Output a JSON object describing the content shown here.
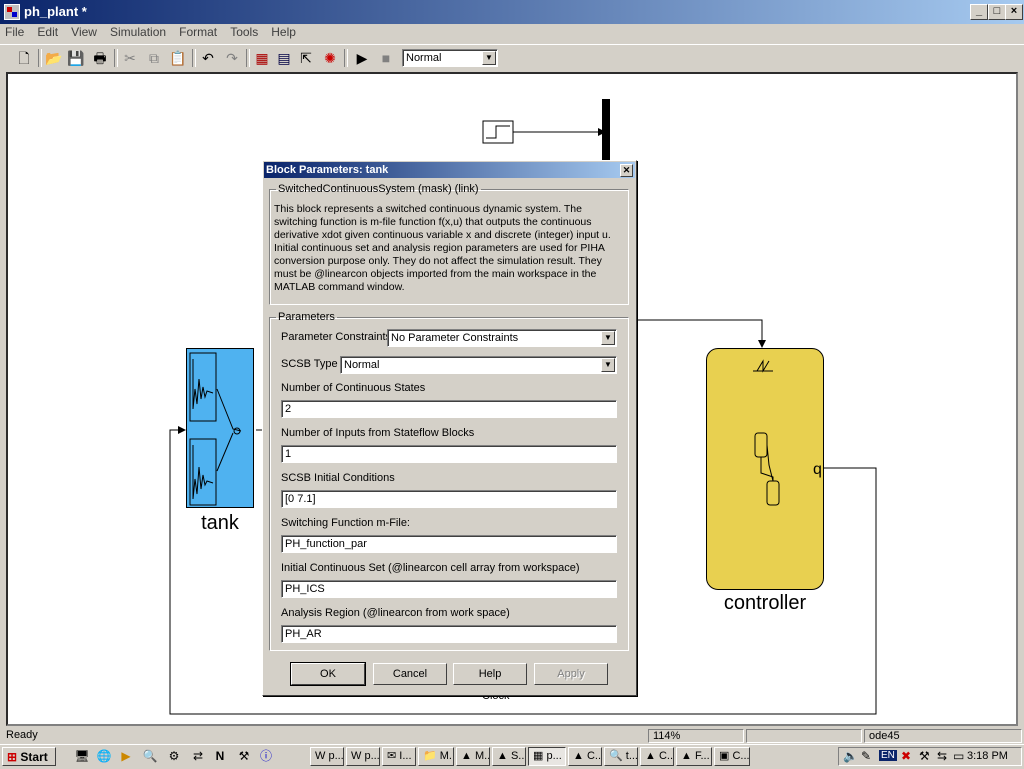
{
  "window": {
    "title": "ph_plant *"
  },
  "menu": [
    "File",
    "Edit",
    "View",
    "Simulation",
    "Format",
    "Tools",
    "Help"
  ],
  "toolbar": {
    "mode_select": "Normal"
  },
  "canvas": {
    "tank_label": "tank",
    "controller_label": "controller",
    "controller_port": "q",
    "hidden_label": "Clock"
  },
  "dialog": {
    "title": "Block Parameters: tank",
    "mask_group": "SwitchedContinuousSystem (mask) (link)",
    "description": "This block represents a switched continuous dynamic system. The switching function is m-file function f(x,u) that outputs the continuous derivative xdot given continuous variable x and discrete (integer) input u. Initial continuous set and analysis region parameters are used for PIHA conversion purpose only. They do not affect the simulation result. They must be @linearcon objects imported from the main workspace in the MATLAB command window.",
    "params_group": "Parameters",
    "param_constraints_label": "Parameter Constraints",
    "param_constraints_value": "No Parameter Constraints",
    "scsb_type_label": "SCSB Type",
    "scsb_type_value": "Normal",
    "num_states_label": "Number of Continuous States",
    "num_states_value": "2",
    "num_inputs_label": "Number of Inputs from Stateflow Blocks",
    "num_inputs_value": "1",
    "init_cond_label": "SCSB Initial Conditions",
    "init_cond_value": "[0 7.1]",
    "switch_fn_label": "Switching Function m-File:",
    "switch_fn_value": "PH_function_par",
    "init_set_label": "Initial Continuous Set (@linearcon cell array from workspace)",
    "init_set_value": "PH_ICS",
    "analysis_label": "Analysis Region (@linearcon from work space)",
    "analysis_value": "PH_AR",
    "ok": "OK",
    "cancel": "Cancel",
    "help": "Help",
    "apply": "Apply"
  },
  "status": {
    "state": "Ready",
    "zoom": "114%",
    "solver": "ode45"
  },
  "taskbar": {
    "start": "Start",
    "tasks": [
      "p...",
      "p...",
      "I...",
      "M...",
      "M...",
      "S...",
      "p...",
      "C...",
      "t...",
      "C...",
      "F...",
      "C..."
    ],
    "lang": "EN",
    "clock": "3:18 PM"
  }
}
